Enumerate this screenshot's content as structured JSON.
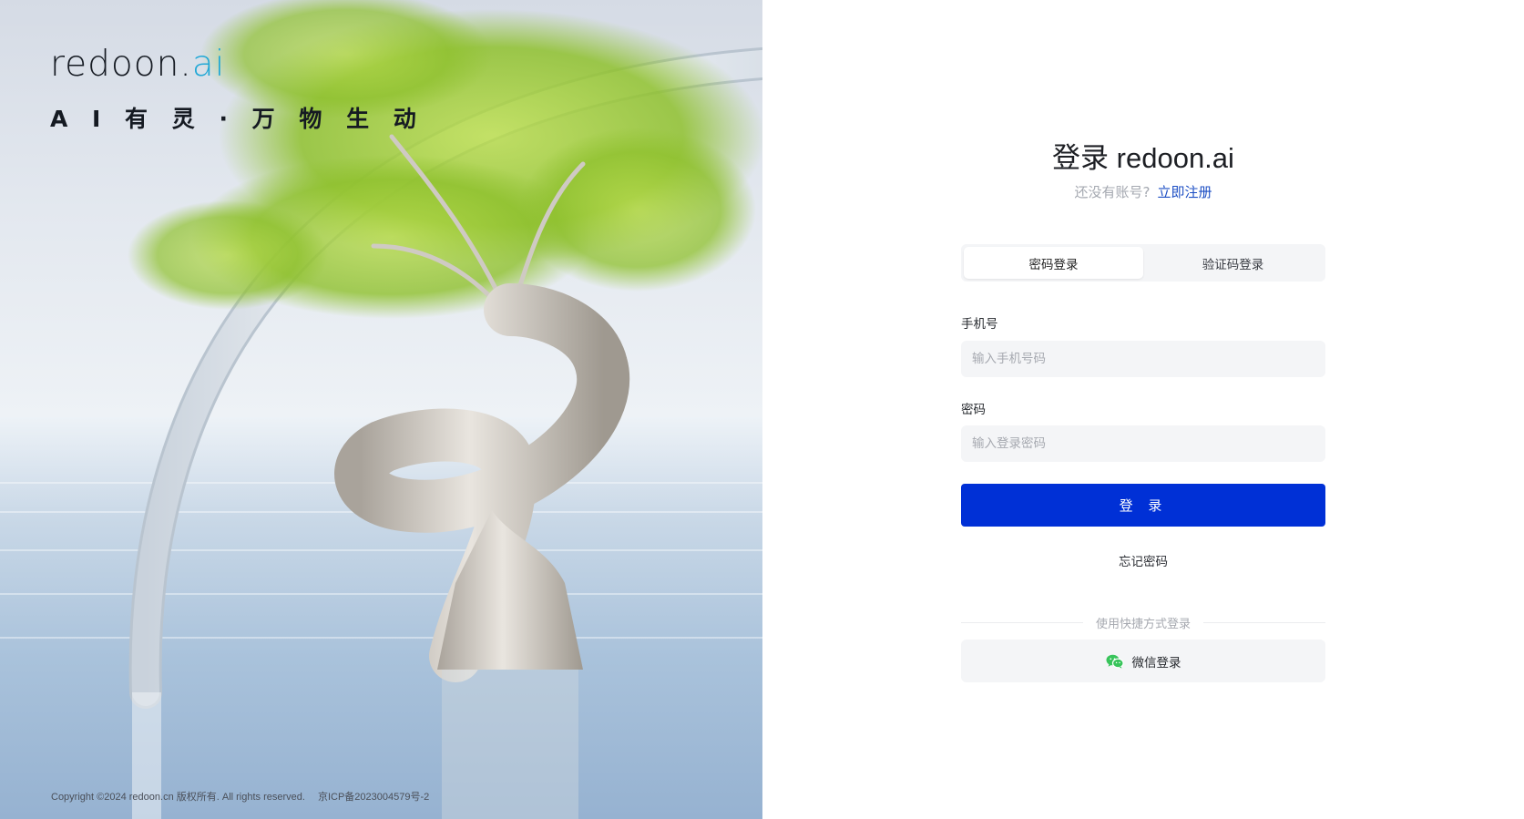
{
  "brand": {
    "logo_main": "redoon",
    "logo_dot": ".",
    "logo_ai": "ai",
    "slogan": "A I 有 灵 · 万 物 生 动"
  },
  "footer": {
    "copyright": "Copyright ©2024 redoon.cn 版权所有. All rights reserved.",
    "icp": "京ICP备2023004579号-2"
  },
  "login": {
    "title": "登录 redoon.ai",
    "no_account": "还没有账号?",
    "signup_link": "立即注册",
    "tabs": [
      {
        "label": "密码登录",
        "active": true
      },
      {
        "label": "验证码登录",
        "active": false
      }
    ],
    "phone_label": "手机号",
    "phone_placeholder": "输入手机号码",
    "password_label": "密码",
    "password_placeholder": "输入登录密码",
    "submit_label": "登 录",
    "forgot_label": "忘记密码",
    "alt_login_divider": "使用快捷方式登录",
    "wechat_label": "微信登录",
    "wechat_icon": "wechat-icon"
  },
  "colors": {
    "primary_button": "#0030d6",
    "link": "#1d4fc4",
    "wechat_green": "#38c45b",
    "logo_ai": "#22a8d6"
  }
}
